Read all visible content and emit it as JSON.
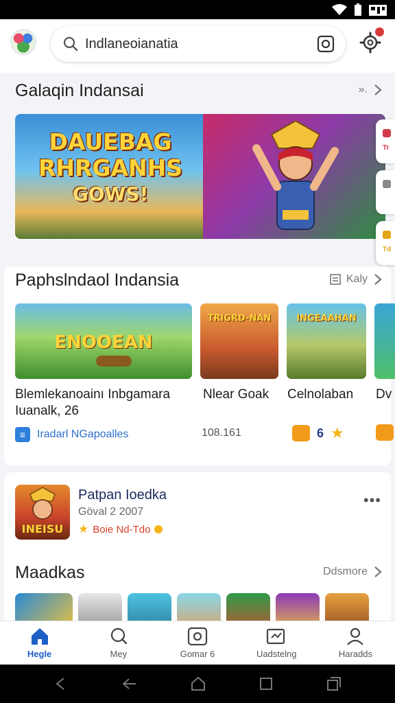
{
  "search": {
    "value": "Indlaneoianatia"
  },
  "sections": {
    "featured": {
      "title": "Galaqin Indansai",
      "action": "»."
    },
    "popular": {
      "title": "Paphslndaol Indansia",
      "action": "Kaly"
    },
    "more": {
      "title": "Maadkas",
      "action": "Ddsmore"
    }
  },
  "banners": [
    {
      "title": "DAUEBAG RHRGANHS",
      "subtitle": "GOWS!"
    }
  ],
  "side_tabs": [
    {
      "label": "Tr",
      "color": "#d33a4a"
    },
    {
      "label": "",
      "color": "#888888"
    },
    {
      "label": "Td",
      "color": "#e3a514"
    }
  ],
  "cards": [
    {
      "thumb_label": "ENOOEAN",
      "title": "Blemlekanoainı Inbgamara Iuanalk, 26"
    },
    {
      "thumb_label": "TRIGRD-NAN",
      "title": "Nlear Goak"
    },
    {
      "thumb_label": "INGEAAHAN",
      "title": "Celnolaban"
    },
    {
      "thumb_label": "",
      "title": "Dv"
    }
  ],
  "meta": {
    "developer": "Iradarl NGapoalles",
    "installs": "108.161",
    "rating": "6"
  },
  "featured_app": {
    "title": "Patpan Ioedka",
    "date": "Göval 2 2007",
    "tag": "Boie Nd-Tdo",
    "icon_label": "INEISU"
  },
  "nav": [
    {
      "label": "Hegle",
      "icon": "home-icon",
      "active": true
    },
    {
      "label": "Mey",
      "icon": "chat-icon",
      "active": false
    },
    {
      "label": "Gomar 6",
      "icon": "games-icon",
      "active": false
    },
    {
      "label": "Uadstelng",
      "icon": "updates-icon",
      "active": false
    },
    {
      "label": "Haradds",
      "icon": "profile-icon",
      "active": false
    }
  ],
  "colors": {
    "accent": "#1e5fc6",
    "notification": "#d93a3a",
    "star": "#f5b51a"
  }
}
